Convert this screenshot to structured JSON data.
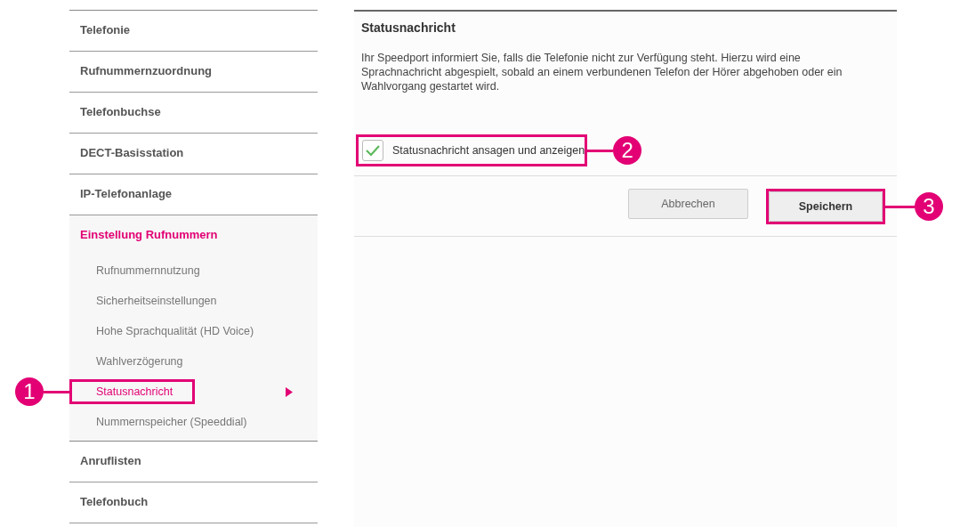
{
  "sidebar": {
    "items": [
      {
        "label": "Telefonie",
        "selected": false
      },
      {
        "label": "Rufnummernzuordnung",
        "selected": false
      },
      {
        "label": "Telefonbuchse",
        "selected": false
      },
      {
        "label": "DECT-Basisstation",
        "selected": false
      },
      {
        "label": "IP-Telefonanlage",
        "selected": false
      },
      {
        "label": "Einstellung Rufnummern",
        "selected": true,
        "children": [
          {
            "label": "Rufnummernnutzung",
            "selected": false
          },
          {
            "label": "Sicherheitseinstellungen",
            "selected": false
          },
          {
            "label": "Hohe Sprachqualität (HD Voice)",
            "selected": false
          },
          {
            "label": "Wahlverzögerung",
            "selected": false
          },
          {
            "label": "Statusnachricht",
            "selected": true,
            "callout": "1"
          },
          {
            "label": "Nummernspeicher (Speeddial)",
            "selected": false
          }
        ]
      },
      {
        "label": "Anruflisten",
        "selected": false
      },
      {
        "label": "Telefonbuch",
        "selected": false
      }
    ]
  },
  "panel": {
    "title": "Statusnachricht",
    "description": "Ihr Speedport informiert Sie, falls die Telefonie nicht zur Verfügung steht. Hierzu wird eine Sprachnachricht abgespielt, sobald an einem verbundenen Telefon der Hörer abgehoben oder ein Wahlvorgang gestartet wird.",
    "checkbox": {
      "label": "Statusnachricht ansagen und anzeigen",
      "checked": true,
      "callout": "2"
    },
    "buttons": [
      {
        "label": "Abbrechen",
        "kind": "secondary"
      },
      {
        "label": "Speichern",
        "kind": "primary",
        "callout": "3"
      }
    ]
  }
}
